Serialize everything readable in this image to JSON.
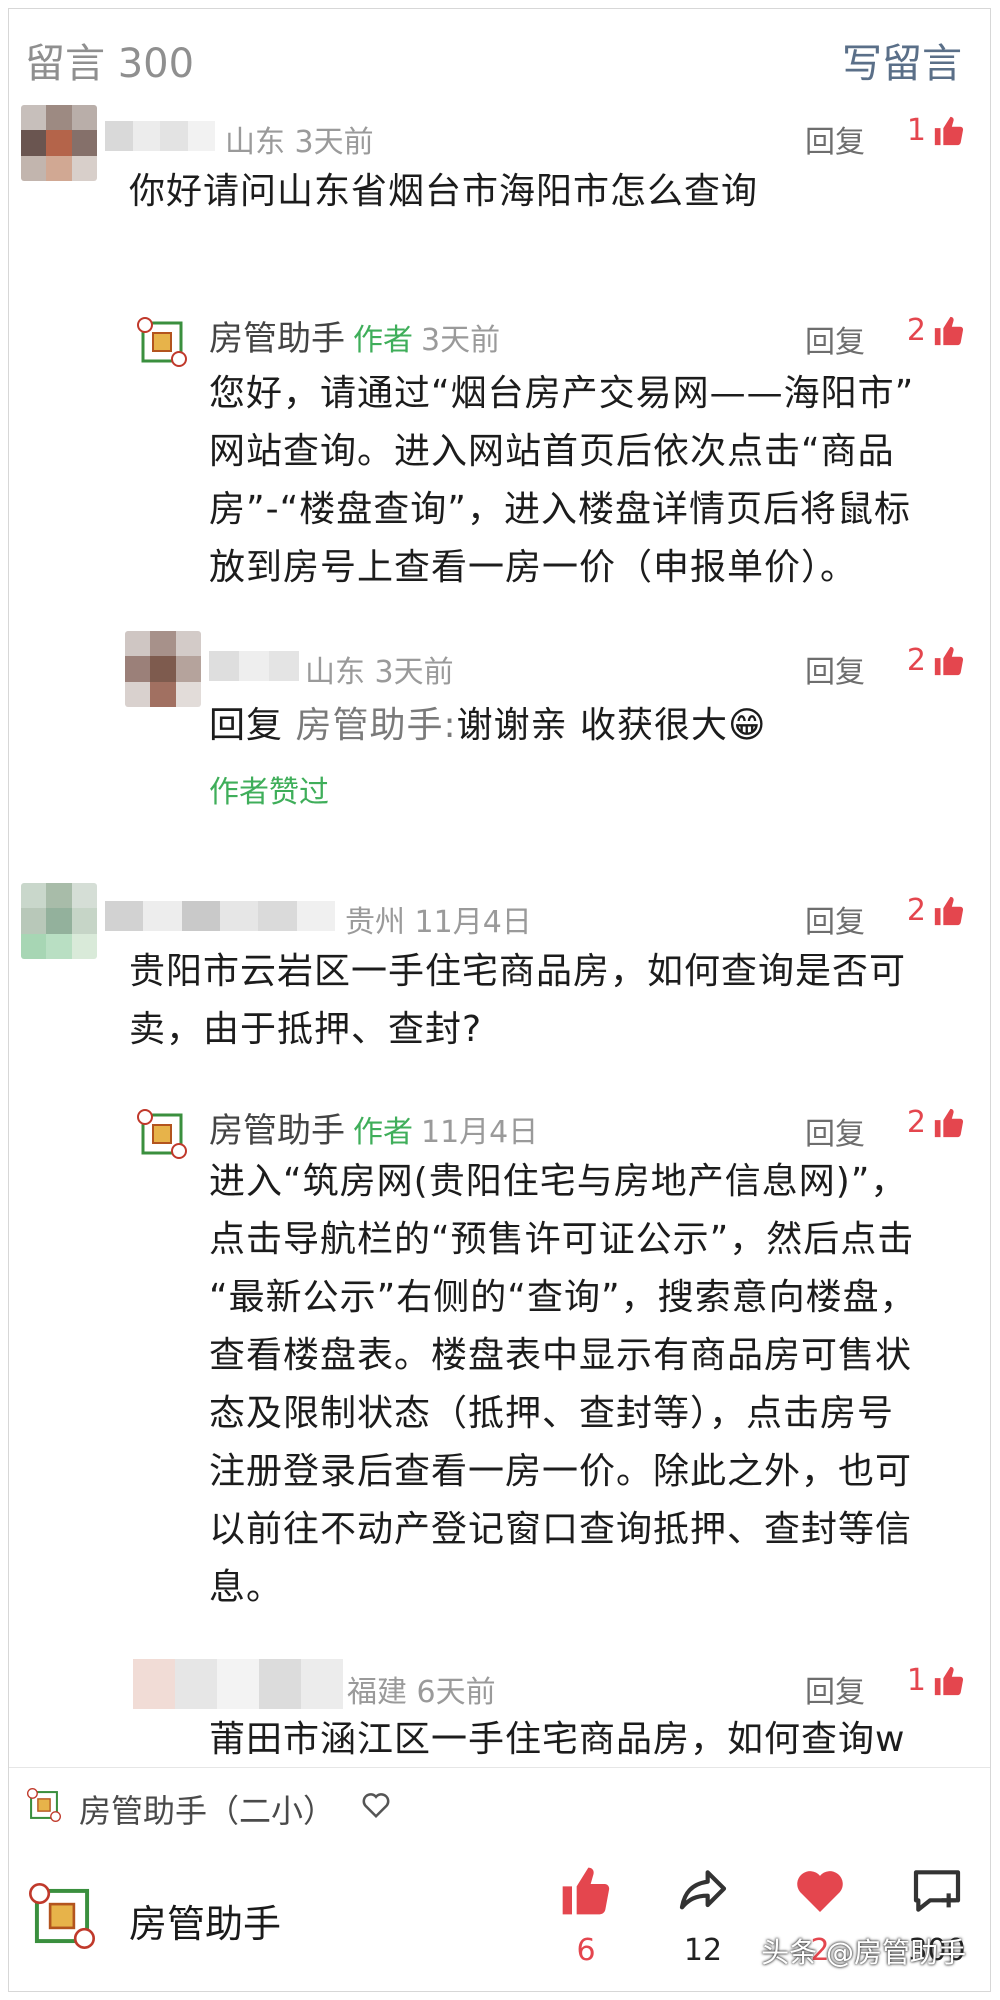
{
  "header": {
    "count_label": "留言 300",
    "write_label": "写留言"
  },
  "comments": [
    {
      "location_time": "山东 3天前",
      "reply": "回复",
      "likes": "1",
      "text": "你好请问山东省烟台市海阳市怎么查询"
    },
    {
      "name": "房管助手",
      "author": "作者",
      "time": "3天前",
      "reply": "回复",
      "likes": "2",
      "lines": [
        "您好，请通过“烟台房产交易网——海阳市”",
        "网站查询。进入网站首页后依次点击“商品",
        "房”-“楼盘查询”，进入楼盘详情页后将鼠标",
        "放到房号上查看一房一价（申报单价）。"
      ]
    },
    {
      "location_time": "山东 3天前",
      "reply": "回复",
      "likes": "2",
      "prefix": "回复",
      "quote": "房管助手:",
      "text": "谢谢亲 收获很大😁",
      "liked": "作者赞过"
    },
    {
      "location_time": "贵州 11月4日",
      "reply": "回复",
      "likes": "2",
      "lines": [
        "贵阳市云岩区一手住宅商品房，如何查询是否可",
        "卖，由于抵押、查封?"
      ]
    },
    {
      "name": "房管助手",
      "author": "作者",
      "time": "11月4日",
      "reply": "回复",
      "likes": "2",
      "lines": [
        "进入“筑房网(贵阳住宅与房地产信息网)”，",
        "点击导航栏的“预售许可证公示”，然后点击",
        "“最新公示”右侧的“查询”，搜索意向楼盘，",
        "查看楼盘表。楼盘表中显示有商品房可售状",
        "态及限制状态（抵押、查封等），点击房号",
        "注册登录后查看一房一价。除此之外，也可",
        "以前往不动产登记窗口查询抵押、查封等信",
        "息。"
      ]
    },
    {
      "location_time": "福建 6天前",
      "reply": "回复",
      "likes": "1",
      "text": "莆田市涵江区一手住宅商品房，如何查询w"
    }
  ],
  "footer": {
    "article_title": "房管助手（二小）",
    "account_name": "房管助手",
    "like_count": "6",
    "share_count": "12",
    "heart_count": "2",
    "comment_count": "300",
    "watermark": "头条 @房管助手"
  },
  "colors": {
    "accent_red": "#e4464e",
    "author_green": "#3fae5a",
    "link_blue": "#5a6f88"
  },
  "icons": [
    "thumbs-up-icon",
    "share-icon",
    "heart-icon",
    "comment-add-icon",
    "logo-icon"
  ]
}
